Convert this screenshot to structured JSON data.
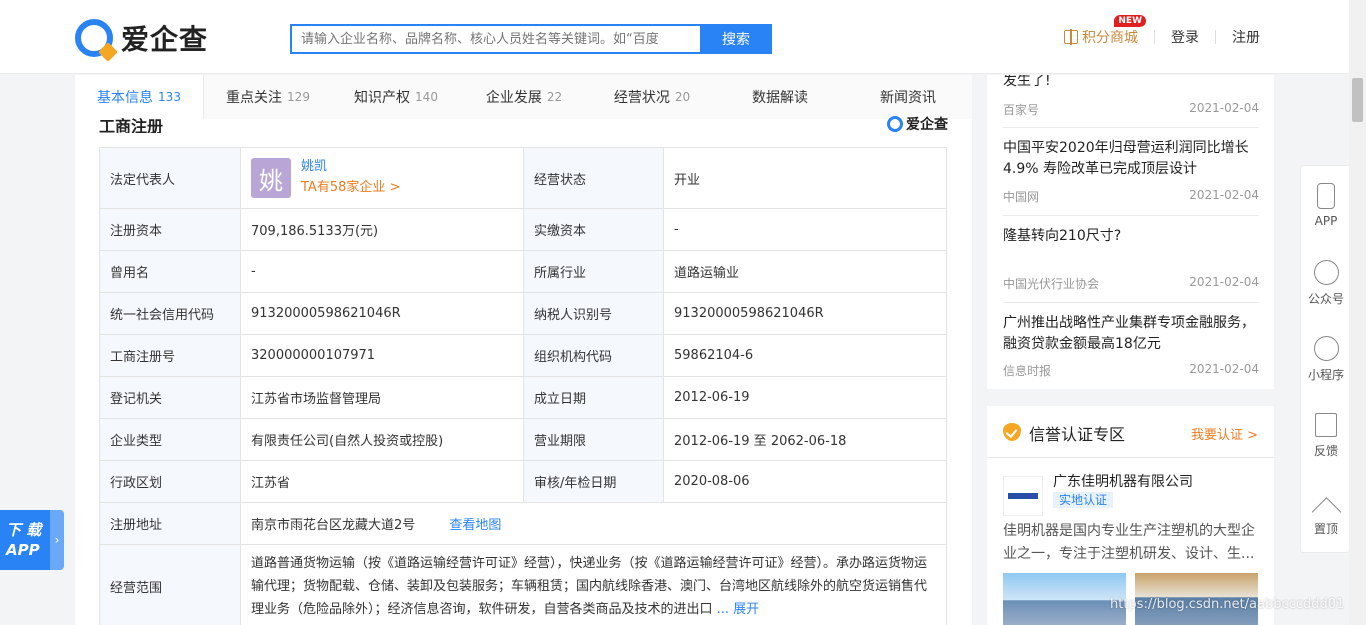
{
  "header": {
    "logo_text": "爱企查",
    "search_placeholder": "请输入企业名称、品牌名称、核心人员姓名等关键词。如“百度",
    "search_button": "搜索",
    "points_mall": "积分商城",
    "new_badge": "NEW",
    "login": "登录",
    "register": "注册"
  },
  "tabs": [
    {
      "label": "基本信息",
      "count": "133"
    },
    {
      "label": "重点关注",
      "count": "129"
    },
    {
      "label": "知识产权",
      "count": "140"
    },
    {
      "label": "企业发展",
      "count": "22"
    },
    {
      "label": "经营状况",
      "count": "20"
    },
    {
      "label": "数据解读",
      "count": ""
    },
    {
      "label": "新闻资讯",
      "count": ""
    }
  ],
  "section": {
    "title": "工商注册",
    "watermark": "爱企查"
  },
  "registration": {
    "legal_rep_label": "法定代表人",
    "legal_rep_avatar": "姚",
    "legal_rep_name": "姚凯",
    "legal_rep_more": "TA有58家企业 >",
    "status_label": "经营状态",
    "status_value": "开业",
    "reg_capital_label": "注册资本",
    "reg_capital_value": "709,186.5133万(元)",
    "paid_capital_label": "实缴资本",
    "paid_capital_value": "-",
    "former_name_label": "曾用名",
    "former_name_value": "-",
    "industry_label": "所属行业",
    "industry_value": "道路运输业",
    "credit_code_label": "统一社会信用代码",
    "credit_code_value": "91320000598621046R",
    "taxpayer_label": "纳税人识别号",
    "taxpayer_value": "91320000598621046R",
    "reg_no_label": "工商注册号",
    "reg_no_value": "320000000107971",
    "org_code_label": "组织机构代码",
    "org_code_value": "59862104-6",
    "authority_label": "登记机关",
    "authority_value": "江苏省市场监督管理局",
    "founded_label": "成立日期",
    "founded_value": "2012-06-19",
    "type_label": "企业类型",
    "type_value": "有限责任公司(自然人投资或控股)",
    "term_label": "营业期限",
    "term_value": "2012-06-19 至 2062-06-18",
    "region_label": "行政区划",
    "region_value": "江苏省",
    "audit_label": "审核/年检日期",
    "audit_value": "2020-08-06",
    "address_label": "注册地址",
    "address_value": "南京市雨花台区龙藏大道2号",
    "map_link": "查看地图",
    "scope_label": "经营范围",
    "scope_value": "道路普通货物运输（按《道路运输经营许可证》经营），快递业务（按《道路运输经营许可证》经营）。承办路运货物运输代理；货物配载、仓储、装卸及包装服务；车辆租赁；国内航线除香港、澳门、台湾地区航线除外的航空货运销售代理业务（危险品除外）；经济信息咨询，软件研发，自营各类商品及技术的进出口",
    "scope_more": "... 展开"
  },
  "news": [
    {
      "title": "发生了!",
      "source": "百家号",
      "date": "2021-02-04"
    },
    {
      "title": "中国平安2020年归母营运利润同比增长4.9% 寿险改革已完成顶层设计",
      "source": "中国网",
      "date": "2021-02-04"
    },
    {
      "title": "隆基转向210尺寸?",
      "source": "中国光伏行业协会",
      "date": "2021-02-04"
    },
    {
      "title": "广州推出战略性产业集群专项金融服务，融资贷款金额最高18亿元",
      "source": "信息时报",
      "date": "2021-02-04"
    }
  ],
  "credibility": {
    "title": "信誉认证专区",
    "link": "我要认证 >",
    "company_name": "广东佳明机器有限公司",
    "verify_tag": "实地认证",
    "description": "佳明机器是国内专业生产注塑机的大型企业之一，专注于注塑机研发、设计、生..."
  },
  "float_bar": {
    "app": "APP",
    "official": "公众号",
    "mini_program": "小程序",
    "feedback": "反馈",
    "top": "置顶"
  },
  "download_app": {
    "line1": "下 载",
    "line2": "APP"
  },
  "url_watermark": "https://blog.csdn.net/aabbcccddd01"
}
